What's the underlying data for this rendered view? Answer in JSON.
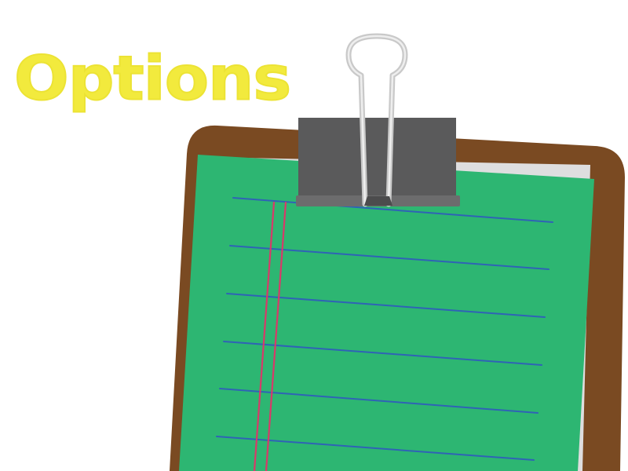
{
  "screen": {
    "title": "Options"
  },
  "colors": {
    "background": "#ffffff",
    "title": "#f2ea3d",
    "clipboard_board": "#7a4a22",
    "paper_underlay": "#dededf",
    "paper": "#2db672",
    "ruled_line": "#2f63b6",
    "margin_line": "#d83a6a",
    "binder_clip": "#5a5a5b",
    "binder_wire": "#c9c9c9"
  },
  "icons": {
    "board": "clipboard-icon",
    "clip": "binder-clip-icon"
  }
}
